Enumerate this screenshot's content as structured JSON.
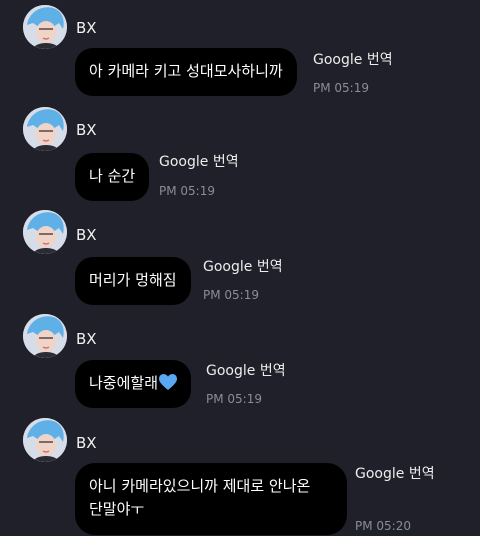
{
  "colors": {
    "background": "#1f2029",
    "bubble": "#000000",
    "time": "#8a8c99",
    "heart": "#5aa7f2"
  },
  "messages": [
    {
      "sender": "BX",
      "text": "아 카메라 키고 성대모사하니까",
      "translate": "Google 번역",
      "time": "PM 05:19"
    },
    {
      "sender": "BX",
      "text": "나 순간",
      "translate": "Google 번역",
      "time": "PM 05:19"
    },
    {
      "sender": "BX",
      "text": "머리가 멍해짐",
      "translate": "Google 번역",
      "time": "PM 05:19"
    },
    {
      "sender": "BX",
      "text": "나중에할래",
      "emoji": "blue-heart-icon",
      "translate": "Google 번역",
      "time": "PM 05:19"
    },
    {
      "sender": "BX",
      "text_lines": [
        "아니 카메라있으니까 제대로 안나온",
        "단말야ㅜ"
      ],
      "translate": "Google 번역",
      "time": "PM 05:20"
    }
  ]
}
